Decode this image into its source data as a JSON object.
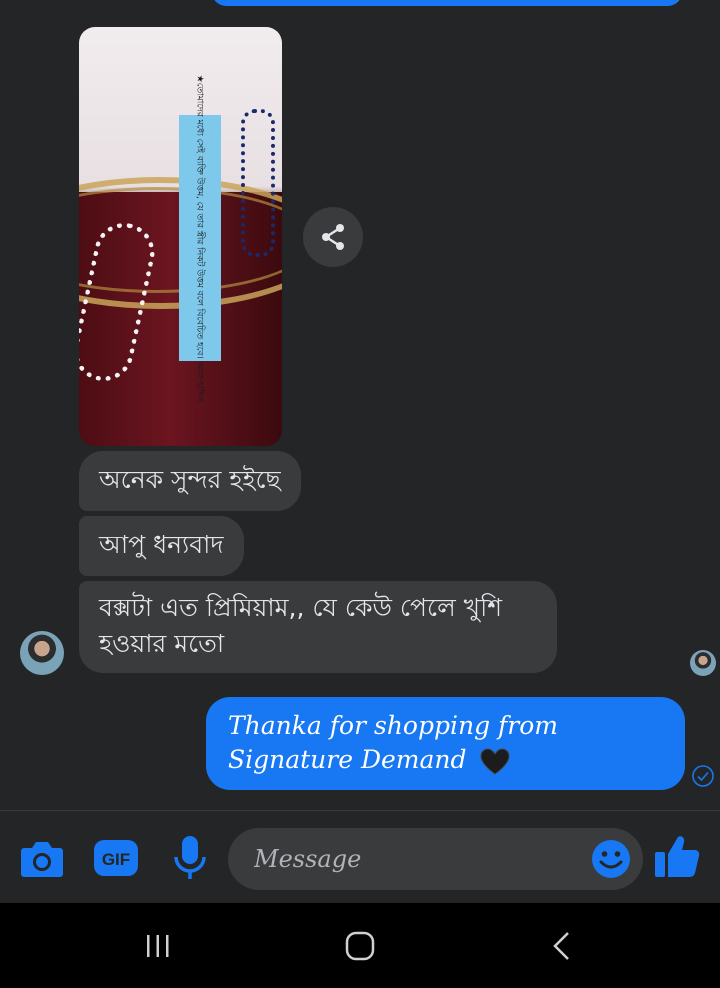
{
  "conversation": {
    "photo_card_text": "★তোমাদের মধ্যে সেই ব্যক্তি উত্তম, যে তার স্ত্রীর নিকট উত্তম বলে বিবেচিত হবে। আল-হাদিস",
    "incoming_messages": [
      {
        "text": "অনেক সুন্দর হইছে"
      },
      {
        "text": "আপু ধন্যবাদ"
      },
      {
        "text": "বক্সটা এত প্রিমিয়াম,, যে কেউ পেলে খুশি হওয়ার মতো"
      }
    ],
    "outgoing_message": {
      "text": "Thanka for shopping from Signature Demand"
    }
  },
  "composer": {
    "message_placeholder": "Message",
    "gif_label": "GIF"
  },
  "icons": {
    "share": "share-icon",
    "camera": "camera-icon",
    "gif": "gif-icon",
    "mic": "microphone-icon",
    "emoji": "emoji-icon",
    "like": "thumbs-up-icon",
    "seen": "seen-check-icon",
    "heart": "black-heart-emoji"
  },
  "colors": {
    "background": "#242526",
    "incoming_bubble": "#3a3b3c",
    "outgoing_bubble": "#1877f2",
    "accent": "#1877f2"
  }
}
